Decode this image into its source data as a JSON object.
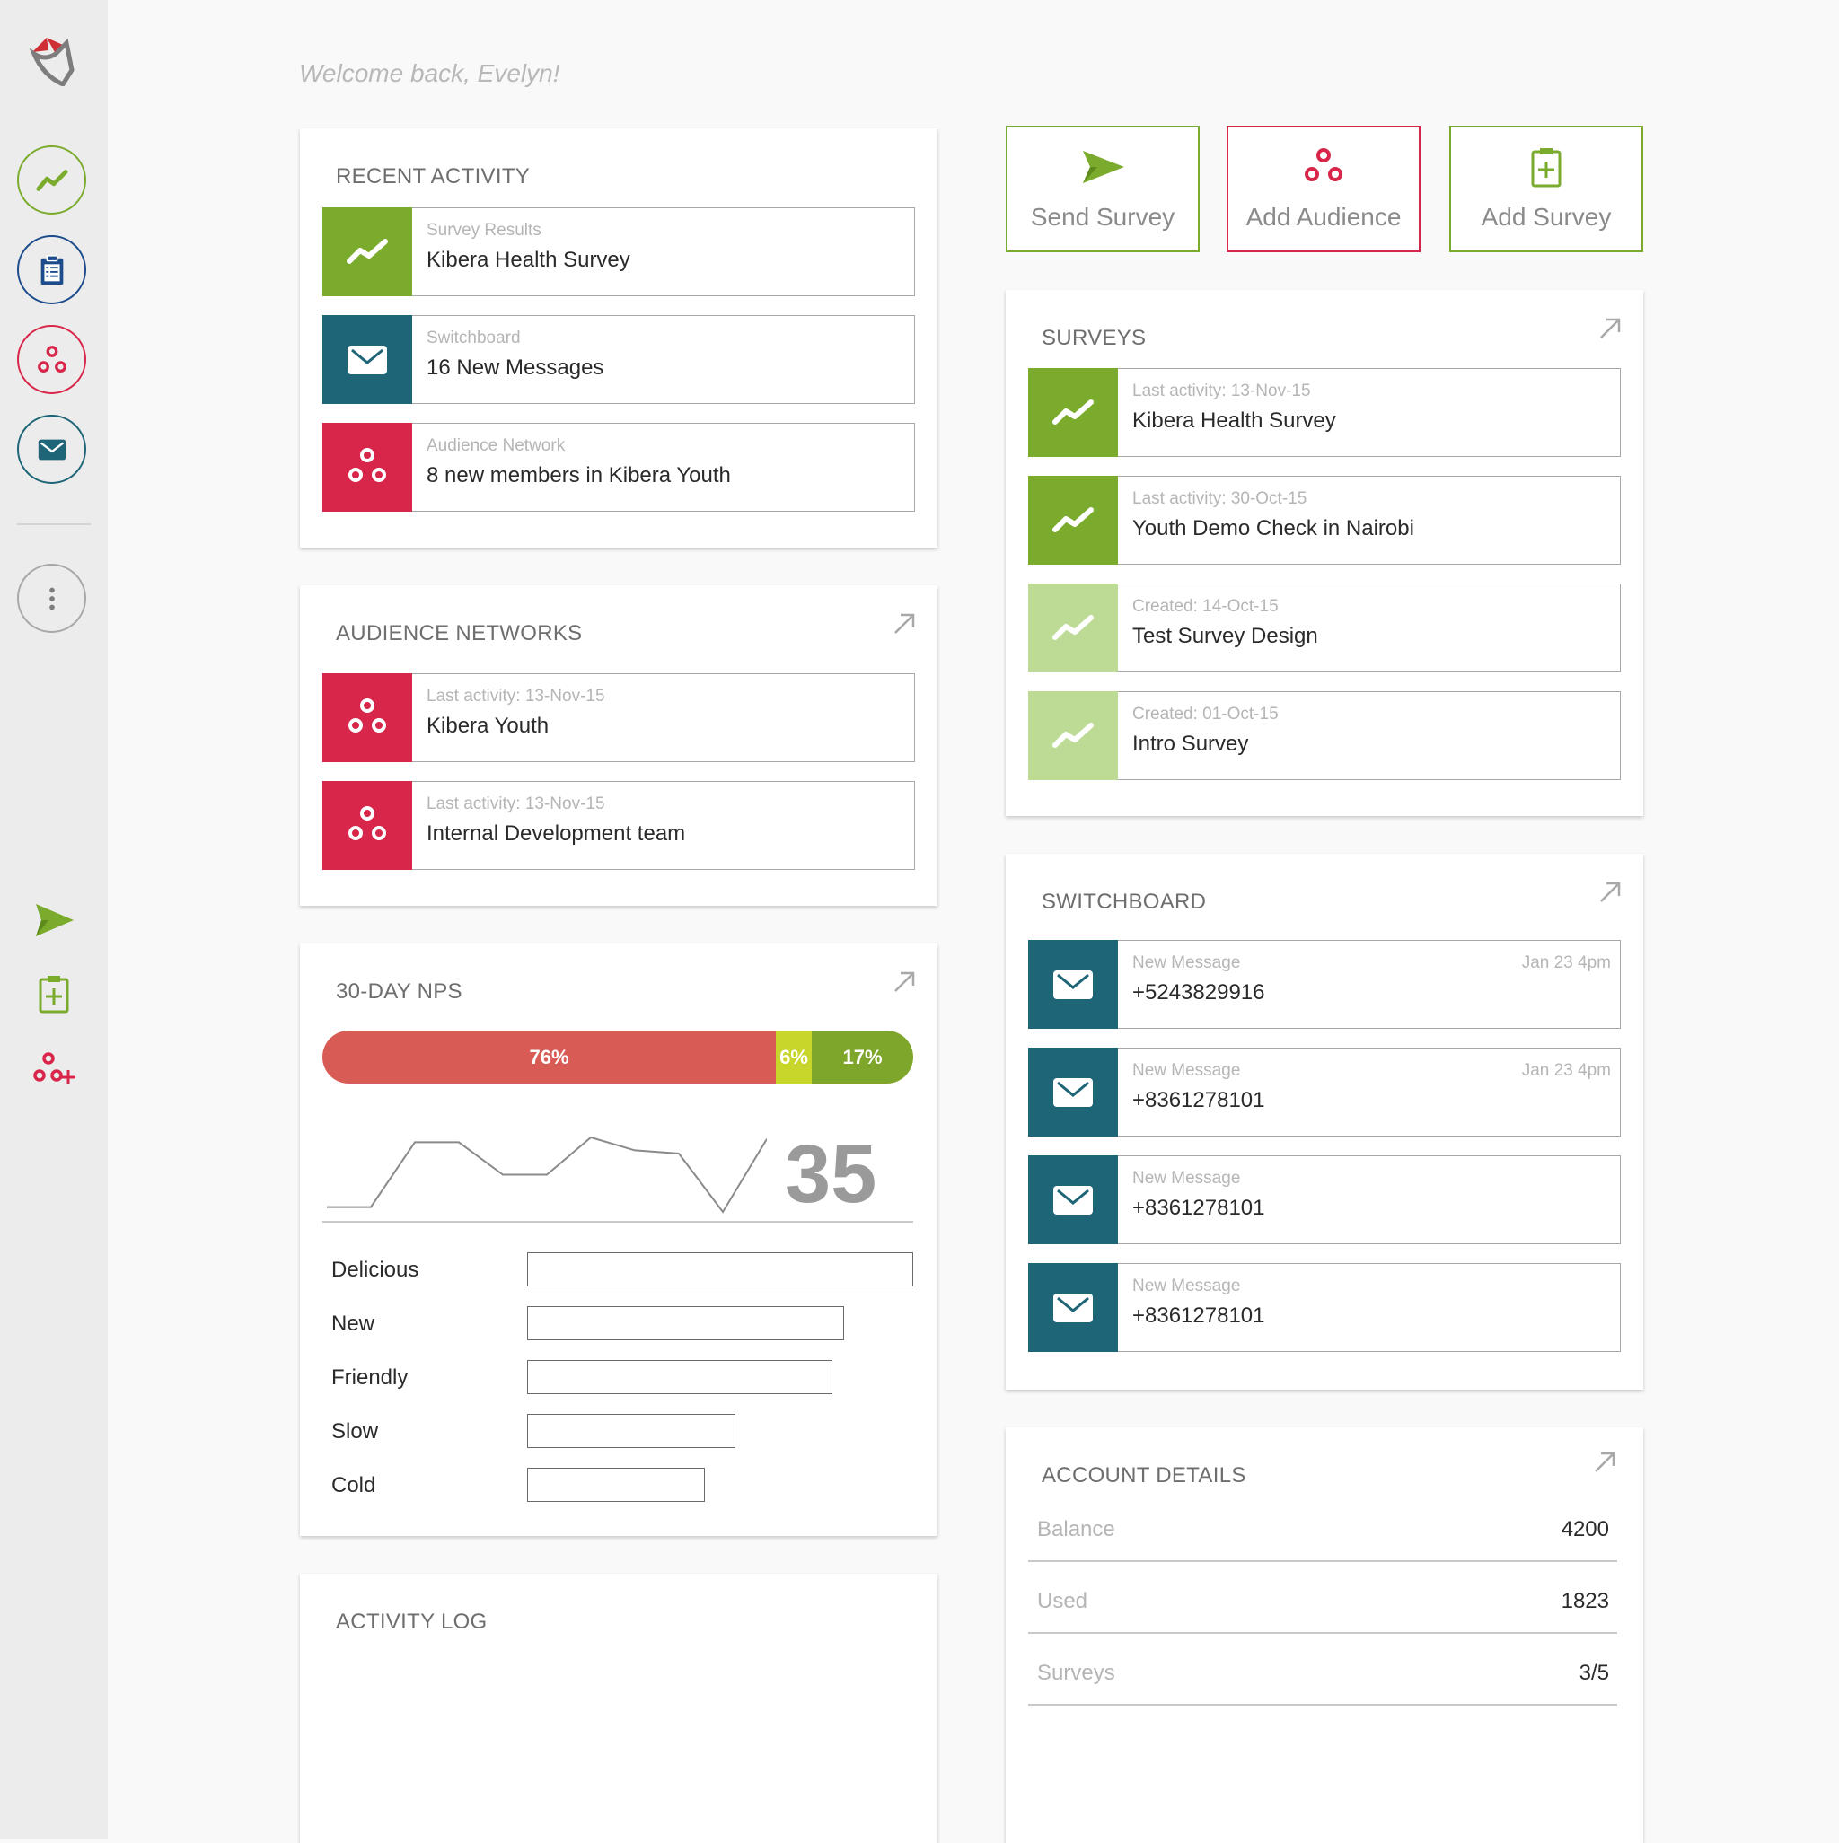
{
  "welcome": "Welcome back, Evelyn!",
  "colors": {
    "green": "#7aab2c",
    "green_light": "#bedb96",
    "red": "#d8264a",
    "teal": "#1d6577",
    "navy": "#1c4c8c",
    "nps_detractors": "#d95b55",
    "nps_passives": "#c8d52a",
    "nps_promoters": "#7ea62a"
  },
  "sidebar": {
    "logo": "app-logo",
    "nav": [
      {
        "icon": "trend-line-icon"
      },
      {
        "icon": "clipboard-list-icon"
      },
      {
        "icon": "audience-network-icon"
      },
      {
        "icon": "mail-icon"
      }
    ],
    "more": {
      "icon": "more-vertical-icon"
    },
    "quick": [
      {
        "icon": "send-icon"
      },
      {
        "icon": "clipboard-add-icon"
      },
      {
        "icon": "audience-add-icon"
      }
    ]
  },
  "actions": [
    {
      "label": "Send Survey",
      "icon": "send-icon"
    },
    {
      "label": "Add Audience",
      "icon": "audience-network-icon"
    },
    {
      "label": "Add Survey",
      "icon": "clipboard-add-icon"
    }
  ],
  "recent_activity": {
    "title": "RECENT ACTIVITY",
    "items": [
      {
        "sub": "Survey Results",
        "main": "Kibera Health Survey"
      },
      {
        "sub": "Switchboard",
        "main": "16 New Messages"
      },
      {
        "sub": "Audience Network",
        "main": "8 new members in Kibera Youth"
      }
    ]
  },
  "audience_networks": {
    "title": "AUDIENCE NETWORKS",
    "items": [
      {
        "sub": "Last activity: 13-Nov-15",
        "main": "Kibera Youth"
      },
      {
        "sub": "Last activity: 13-Nov-15",
        "main": "Internal Development team"
      }
    ]
  },
  "nps": {
    "title": "30-DAY NPS",
    "segments": [
      {
        "label": "76%",
        "value": 76
      },
      {
        "label": "6%",
        "value": 6
      },
      {
        "label": "17%",
        "value": 17
      }
    ],
    "score": "35",
    "trend": [
      3,
      3,
      43,
      43,
      23,
      23,
      46,
      38,
      36,
      0,
      45
    ],
    "attributes": [
      {
        "label": "Delicious",
        "fraction": 1.0
      },
      {
        "label": "New",
        "fraction": 0.82
      },
      {
        "label": "Friendly",
        "fraction": 0.79
      },
      {
        "label": "Slow",
        "fraction": 0.54
      },
      {
        "label": "Cold",
        "fraction": 0.46
      }
    ]
  },
  "activity_log": {
    "title": "ACTIVITY LOG"
  },
  "surveys": {
    "title": "SURVEYS",
    "items": [
      {
        "sub": "Last activity: 13-Nov-15",
        "main": "Kibera Health Survey",
        "active": true
      },
      {
        "sub": "Last activity: 30-Oct-15",
        "main": "Youth Demo Check in Nairobi",
        "active": true
      },
      {
        "sub": "Created: 14-Oct-15",
        "main": "Test Survey Design",
        "active": false
      },
      {
        "sub": "Created: 01-Oct-15",
        "main": "Intro Survey",
        "active": false
      }
    ]
  },
  "switchboard": {
    "title": "SWITCHBOARD",
    "items": [
      {
        "sub": "New Message",
        "main": "+5243829916",
        "time": "Jan 23 4pm"
      },
      {
        "sub": "New Message",
        "main": "+8361278101",
        "time": "Jan 23 4pm"
      },
      {
        "sub": "New Message",
        "main": "+8361278101",
        "time": ""
      },
      {
        "sub": "New Message",
        "main": "+8361278101",
        "time": ""
      }
    ]
  },
  "account": {
    "title": "ACCOUNT DETAILS",
    "rows": [
      {
        "label": "Balance",
        "value": "4200"
      },
      {
        "label": "Used",
        "value": "1823"
      },
      {
        "label": "Surveys",
        "value": "3/5"
      }
    ]
  }
}
